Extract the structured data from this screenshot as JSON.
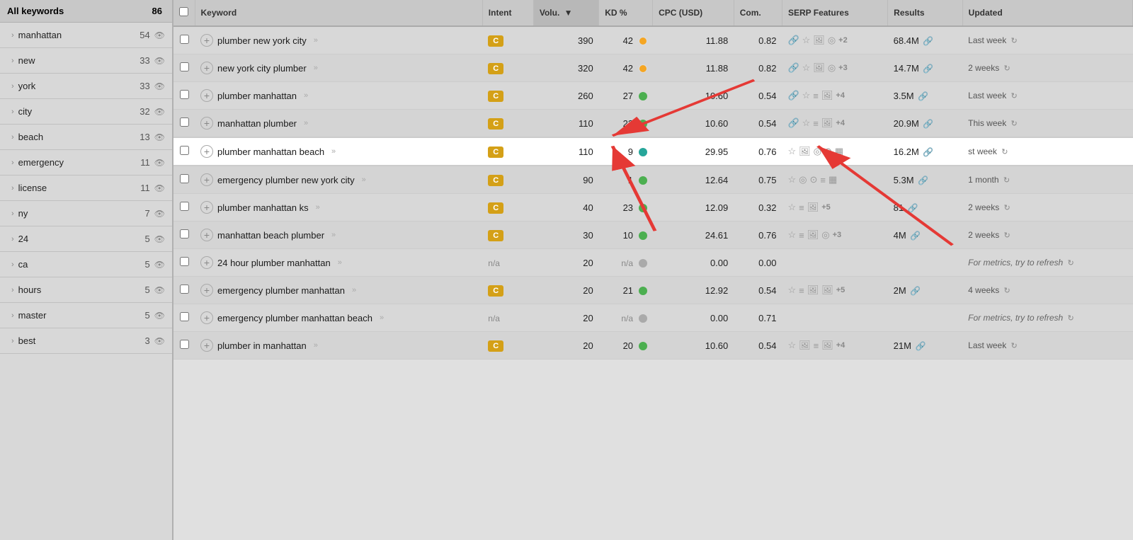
{
  "sidebar": {
    "header": {
      "label": "All keywords",
      "count": "86"
    },
    "items": [
      {
        "label": "manhattan",
        "count": "54"
      },
      {
        "label": "new",
        "count": "33"
      },
      {
        "label": "york",
        "count": "33"
      },
      {
        "label": "city",
        "count": "32"
      },
      {
        "label": "beach",
        "count": "13"
      },
      {
        "label": "emergency",
        "count": "11"
      },
      {
        "label": "license",
        "count": "11"
      },
      {
        "label": "ny",
        "count": "7"
      },
      {
        "label": "24",
        "count": "5"
      },
      {
        "label": "ca",
        "count": "5"
      },
      {
        "label": "hours",
        "count": "5"
      },
      {
        "label": "master",
        "count": "5"
      },
      {
        "label": "best",
        "count": "3"
      }
    ]
  },
  "table": {
    "headers": {
      "keyword": "Keyword",
      "intent": "Intent",
      "volume": "Volu.",
      "kd": "KD %",
      "cpc": "CPC (USD)",
      "com": "Com.",
      "serp": "SERP Features",
      "results": "Results",
      "updated": "Updated"
    },
    "rows": [
      {
        "id": 1,
        "keyword": "plumber new york city",
        "intent": "C",
        "volume": "390",
        "kd": "42",
        "kd_type": "yellow",
        "cpc": "11.88",
        "com": "0.82",
        "serp_icons": [
          "link",
          "star",
          "image",
          "target"
        ],
        "serp_plus": "+2",
        "results": "68.4M",
        "updated": "Last week",
        "highlighted": false
      },
      {
        "id": 2,
        "keyword": "new york city plumber",
        "intent": "C",
        "volume": "320",
        "kd": "42",
        "kd_type": "yellow",
        "cpc": "11.88",
        "com": "0.82",
        "serp_icons": [
          "link",
          "star",
          "image",
          "target"
        ],
        "serp_plus": "+3",
        "results": "14.7M",
        "updated": "2 weeks",
        "highlighted": false
      },
      {
        "id": 3,
        "keyword": "plumber manhattan",
        "intent": "C",
        "volume": "260",
        "kd": "27",
        "kd_type": "green",
        "cpc": "10.60",
        "com": "0.54",
        "serp_icons": [
          "link",
          "star",
          "list",
          "image"
        ],
        "serp_plus": "+4",
        "results": "3.5M",
        "updated": "Last week",
        "highlighted": false
      },
      {
        "id": 4,
        "keyword": "manhattan plumber",
        "intent": "C",
        "volume": "110",
        "kd": "22",
        "kd_type": "green",
        "cpc": "10.60",
        "com": "0.54",
        "serp_icons": [
          "link",
          "star",
          "list",
          "image"
        ],
        "serp_plus": "+4",
        "results": "20.9M",
        "updated": "This week",
        "highlighted": false
      },
      {
        "id": 5,
        "keyword": "plumber manhattan beach",
        "intent": "C",
        "volume": "110",
        "kd": "9",
        "kd_type": "teal",
        "cpc": "29.95",
        "com": "0.76",
        "serp_icons": [
          "star",
          "image",
          "target",
          "map",
          "calendar"
        ],
        "serp_plus": null,
        "results": "16.2M",
        "updated": "st week",
        "highlighted": true
      },
      {
        "id": 6,
        "keyword": "emergency plumber new york city",
        "intent": "C",
        "volume": "90",
        "kd": "1",
        "kd_type": "green",
        "cpc": "12.64",
        "com": "0.75",
        "serp_icons": [
          "star",
          "target",
          "map",
          "list",
          "calendar"
        ],
        "serp_plus": null,
        "results": "5.3M",
        "updated": "1 month",
        "highlighted": false
      },
      {
        "id": 7,
        "keyword": "plumber manhattan ks",
        "intent": "C",
        "volume": "40",
        "kd": "23",
        "kd_type": "green",
        "cpc": "12.09",
        "com": "0.32",
        "serp_icons": [
          "star",
          "list",
          "image"
        ],
        "serp_plus": "+5",
        "results": "81",
        "updated": "2 weeks",
        "highlighted": false
      },
      {
        "id": 8,
        "keyword": "manhattan beach plumber",
        "intent": "C",
        "volume": "30",
        "kd": "10",
        "kd_type": "green",
        "cpc": "24.61",
        "com": "0.76",
        "serp_icons": [
          "star",
          "list",
          "image",
          "target"
        ],
        "serp_plus": "+3",
        "results": "4M",
        "updated": "2 weeks",
        "highlighted": false
      },
      {
        "id": 9,
        "keyword": "24 hour plumber manhattan",
        "intent": "n/a",
        "volume": "20",
        "kd": "n/a",
        "kd_type": "gray",
        "cpc": "0.00",
        "com": "0.00",
        "serp_icons": [],
        "serp_plus": null,
        "results": "",
        "updated": "For metrics, try to refresh",
        "highlighted": false
      },
      {
        "id": 10,
        "keyword": "emergency plumber manhattan",
        "intent": "C",
        "volume": "20",
        "kd": "21",
        "kd_type": "green",
        "cpc": "12.92",
        "com": "0.54",
        "serp_icons": [
          "star",
          "list",
          "image",
          "image2"
        ],
        "serp_plus": "+5",
        "results": "2M",
        "updated": "4 weeks",
        "highlighted": false
      },
      {
        "id": 11,
        "keyword": "emergency plumber manhattan beach",
        "intent": "n/a",
        "volume": "20",
        "kd": "n/a",
        "kd_type": "gray",
        "cpc": "0.00",
        "com": "0.71",
        "serp_icons": [],
        "serp_plus": null,
        "results": "",
        "updated": "For metrics, try to refresh",
        "highlighted": false
      },
      {
        "id": 12,
        "keyword": "plumber in manhattan",
        "intent": "C",
        "volume": "20",
        "kd": "20",
        "kd_type": "green",
        "cpc": "10.60",
        "com": "0.54",
        "serp_icons": [
          "star",
          "image",
          "list",
          "image2"
        ],
        "serp_plus": "+4",
        "results": "21M",
        "updated": "Last week",
        "highlighted": false
      }
    ]
  }
}
